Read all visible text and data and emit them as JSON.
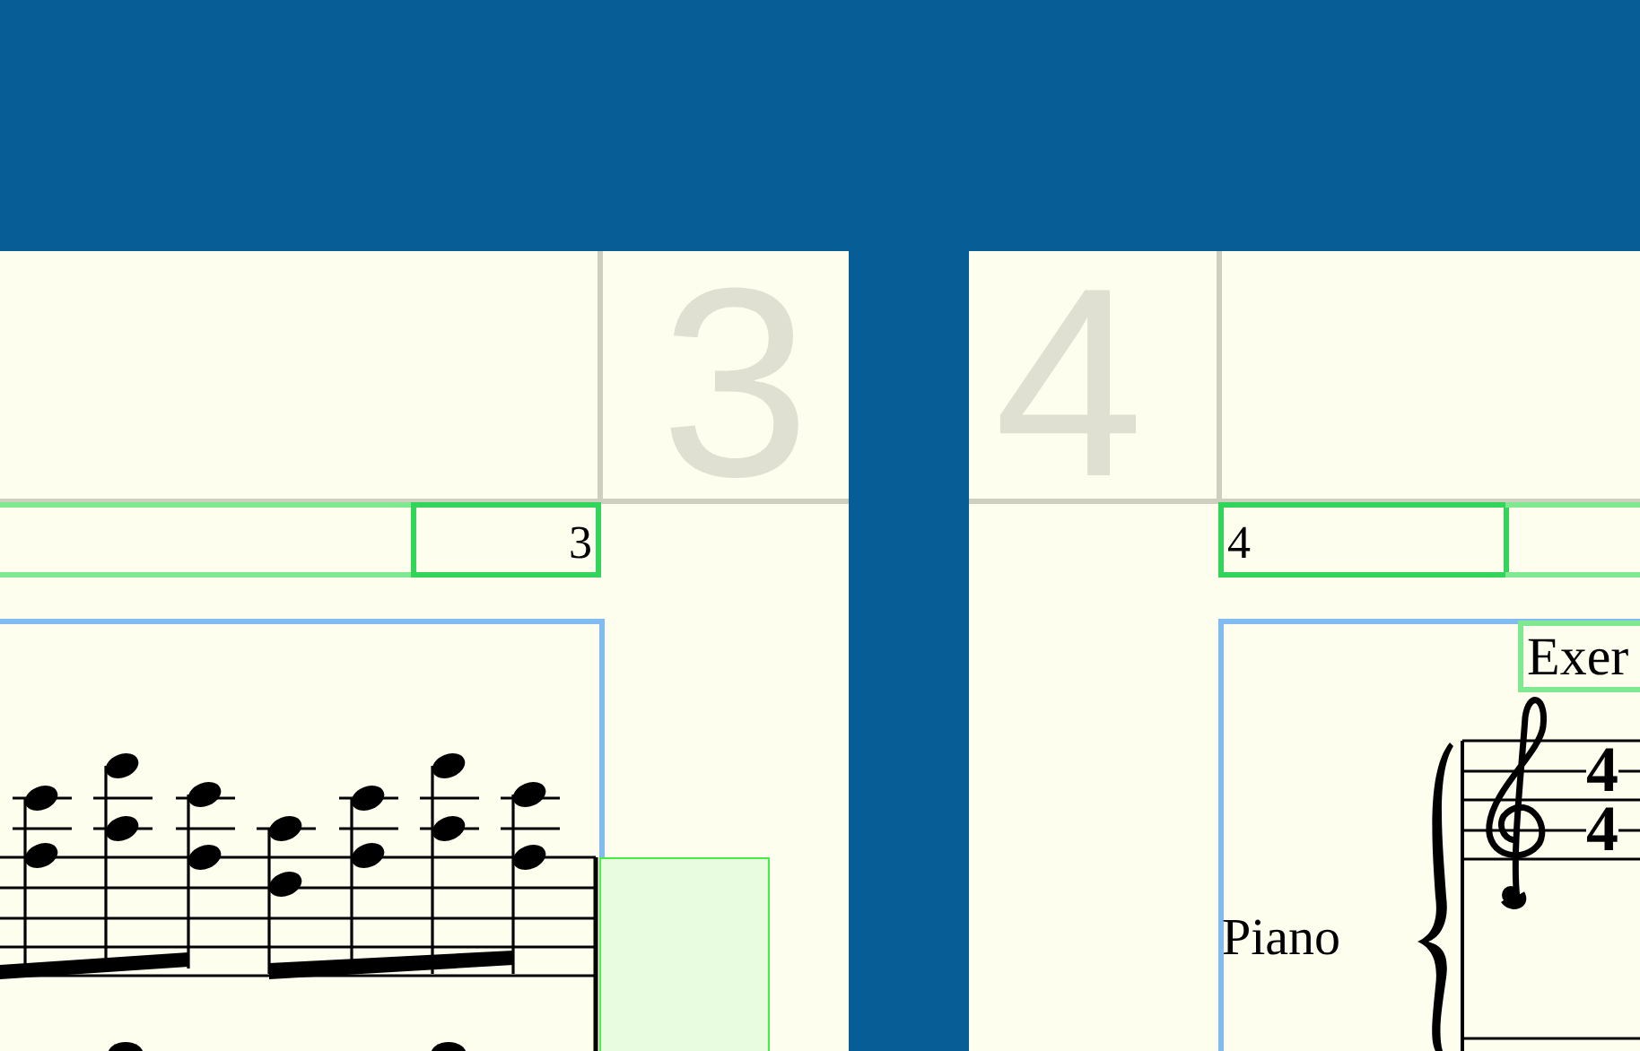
{
  "pages": [
    {
      "kind": "system-end",
      "page_number": "3",
      "header_number": "3"
    },
    {
      "kind": "system-start",
      "page_number": "4",
      "header_number": "4",
      "title": "Exer",
      "instrument": "Piano",
      "time_signature": [
        "4",
        "4"
      ]
    }
  ]
}
